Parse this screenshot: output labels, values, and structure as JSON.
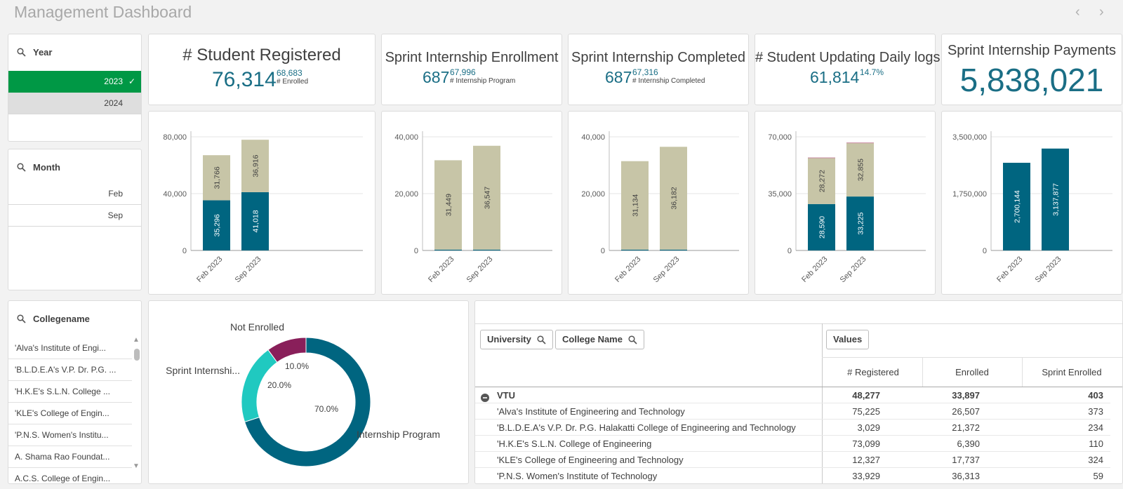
{
  "header": {
    "title": "Management Dashboard",
    "prev_icon": "chevron-left-icon",
    "next_icon": "chevron-right-icon"
  },
  "filters": {
    "year": {
      "label": "Year",
      "items": [
        "2023",
        "2024"
      ],
      "selected": "2023"
    },
    "month": {
      "label": "Month",
      "items": [
        "Feb",
        "Sep"
      ]
    },
    "college": {
      "label": "Collegename",
      "items": [
        "'Alva's Institute of Engi...",
        "'B.L.D.E.A's V.P. Dr. P.G. ...",
        "'H.K.E's S.L.N. College ...",
        "'KLE's College of Engin...",
        "'P.N.S. Women's Institu...",
        "A. Shama Rao Foundat...",
        "A.C.S. College of Engin..."
      ]
    }
  },
  "kpis": [
    {
      "title": "# Student Registered",
      "main": "76,314",
      "sup": "68,683",
      "sub": "# Enrolled"
    },
    {
      "title": "Sprint Internship Enrollment",
      "main": "687",
      "sup": "67,996",
      "sub": "# Internship Program"
    },
    {
      "title": "Sprint Internship Completed",
      "main": "687",
      "sup": "67,316",
      "sub": "# Internship Completed"
    },
    {
      "title": "# Student Updating Daily logs",
      "main": "61,814",
      "sup": "14.7%",
      "sub": ""
    },
    {
      "title": "Sprint Internship Payments",
      "main": "5,838,021",
      "sup": "",
      "sub": ""
    }
  ],
  "chart_data": [
    {
      "type": "bar",
      "stacked": true,
      "categories": [
        "Feb 2023",
        "Sep 2023"
      ],
      "ylim": [
        0,
        80000
      ],
      "yticks": [
        "0",
        "40,000",
        "80,000"
      ],
      "grid": true,
      "series": [
        {
          "values": [
            35296,
            41018
          ],
          "labels": [
            "35,296",
            "41,018"
          ],
          "color": "#006580"
        },
        {
          "values": [
            31766,
            36916
          ],
          "labels": [
            "31,766",
            "36,916"
          ],
          "color": "#c7c5a7"
        }
      ]
    },
    {
      "type": "bar",
      "stacked": true,
      "categories": [
        "Feb 2023",
        "Sep 2023"
      ],
      "ylim": [
        0,
        40000
      ],
      "yticks": [
        "0",
        "20,000",
        "40,000"
      ],
      "grid": true,
      "series": [
        {
          "values": [
            300,
            300
          ],
          "labels": [
            "",
            ""
          ],
          "color": "#006580"
        },
        {
          "values": [
            31449,
            36547
          ],
          "labels": [
            "31,449",
            "36,547"
          ],
          "color": "#c7c5a7"
        }
      ]
    },
    {
      "type": "bar",
      "stacked": true,
      "categories": [
        "Feb 2023",
        "Sep 2023"
      ],
      "ylim": [
        0,
        40000
      ],
      "yticks": [
        "0",
        "20,000",
        "40,000"
      ],
      "grid": true,
      "series": [
        {
          "values": [
            300,
            300
          ],
          "labels": [
            "",
            ""
          ],
          "color": "#006580"
        },
        {
          "values": [
            31134,
            36182
          ],
          "labels": [
            "31,134",
            "36,182"
          ],
          "color": "#c7c5a7"
        }
      ]
    },
    {
      "type": "bar",
      "stacked": true,
      "categories": [
        "Feb 2023",
        "Sep 2023"
      ],
      "ylim": [
        0,
        70000
      ],
      "yticks": [
        "0",
        "35,000",
        "70,000"
      ],
      "grid": true,
      "series": [
        {
          "values": [
            28590,
            33225
          ],
          "labels": [
            "28,590",
            "33,225"
          ],
          "color": "#006580"
        },
        {
          "values": [
            28272,
            32855
          ],
          "labels": [
            "28,272",
            "32,855"
          ],
          "color": "#c7c5a7"
        },
        {
          "values": [
            400,
            400
          ],
          "labels": [
            "",
            ""
          ],
          "color": "#c5869c"
        }
      ]
    },
    {
      "type": "bar",
      "stacked": false,
      "categories": [
        "Feb 2023",
        "Sep 2023"
      ],
      "ylim": [
        0,
        3500000
      ],
      "yticks": [
        "0",
        "1,750,000",
        "3,500,000"
      ],
      "grid": true,
      "series": [
        {
          "values": [
            2700144,
            3137877
          ],
          "labels": [
            "2,700,144",
            "3,137,877"
          ],
          "color": "#006580"
        }
      ]
    },
    {
      "type": "pie",
      "donut": true,
      "slices": [
        {
          "name": "Internship Program",
          "value": 70.0,
          "label": "70.0%",
          "color": "#006580"
        },
        {
          "name": "Sprint Internshi...",
          "value": 20.0,
          "label": "20.0%",
          "color": "#20c9c0"
        },
        {
          "name": "Not Enrolled",
          "value": 10.0,
          "label": "10.0%",
          "color": "#891f5a"
        }
      ]
    }
  ],
  "table": {
    "dim_buttons": [
      "University",
      "College Name"
    ],
    "values_button": "Values",
    "columns": [
      "# Registered",
      "Enrolled",
      "Sprint Enrolled"
    ],
    "group": {
      "name": "VTU",
      "values": [
        "48,277",
        "33,897",
        "403"
      ],
      "icon": "collapse-minus-icon"
    },
    "rows": [
      {
        "name": "'Alva's Institute of Engineering and Technology",
        "values": [
          "75,225",
          "26,507",
          "373"
        ]
      },
      {
        "name": "'B.L.D.E.A's V.P. Dr. P.G. Halakatti College of Engineering and Technology",
        "values": [
          "3,029",
          "21,372",
          "234"
        ]
      },
      {
        "name": "'H.K.E's S.L.N. College of Engineering",
        "values": [
          "73,099",
          "6,390",
          "110"
        ]
      },
      {
        "name": "'KLE's College of Engineering and Technology",
        "values": [
          "12,327",
          "17,737",
          "324"
        ]
      },
      {
        "name": "'P.N.S. Women's Institute of Technology",
        "values": [
          "33,929",
          "36,313",
          "59"
        ]
      }
    ]
  }
}
